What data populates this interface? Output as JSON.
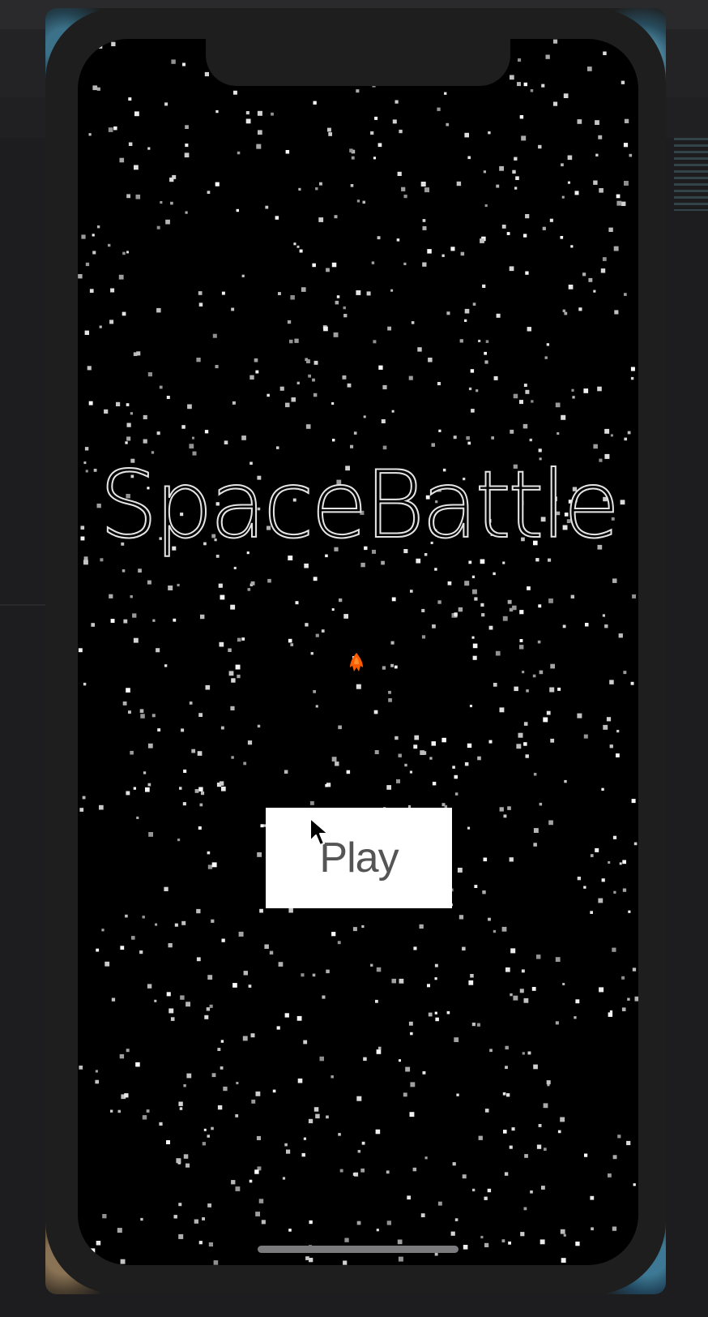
{
  "game": {
    "title": "SpaceBattle",
    "play_label": "Play"
  },
  "icons": {
    "ship": "player-ship-icon",
    "cursor": "mouse-pointer-icon"
  },
  "colors": {
    "background": "#000000",
    "title_outline": "#e4e4e4",
    "ship": "#ff5a00",
    "button": "#ffffff",
    "button_text": "#555555",
    "device_frame": "#1e1e1e"
  }
}
